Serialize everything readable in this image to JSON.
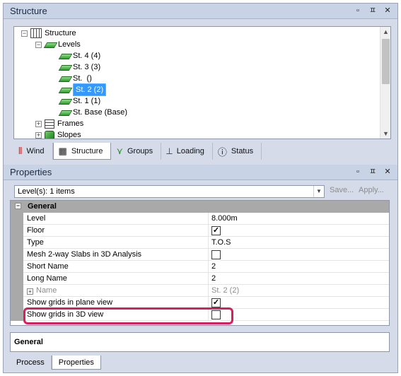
{
  "structure_panel": {
    "title": "Structure",
    "controls": [
      "▫",
      "ㅍ",
      "✕"
    ],
    "tree": {
      "root": "Structure",
      "levels_label": "Levels",
      "levels": [
        "St. 4 (4)",
        "St. 3 (3)",
        "St.  ()",
        "St. 2 (2)",
        "St. 1 (1)",
        "St. Base (Base)"
      ],
      "selected_level": "St. 2 (2)",
      "frames": "Frames",
      "slopes": "Slopes"
    },
    "tabs": [
      {
        "label": "Wind",
        "icon": "wind-icon"
      },
      {
        "label": "Structure",
        "icon": "structure-icon"
      },
      {
        "label": "Groups",
        "icon": "groups-icon"
      },
      {
        "label": "Loading",
        "icon": "loading-icon"
      },
      {
        "label": "Status",
        "icon": "status-icon"
      }
    ],
    "active_tab": "Structure"
  },
  "properties_panel": {
    "title": "Properties",
    "controls": [
      "▫",
      "ㅍ",
      "✕"
    ],
    "selector_value": "Level(s): 1 items",
    "save_label": "Save...",
    "apply_label": "Apply...",
    "category": "General",
    "rows": [
      {
        "name": "Level",
        "value": "8.000m"
      },
      {
        "name": "Floor",
        "checked": true
      },
      {
        "name": "Type",
        "value": "T.O.S"
      },
      {
        "name": "Mesh 2-way Slabs in 3D Analysis",
        "checked": false
      },
      {
        "name": "Short Name",
        "value": "2"
      },
      {
        "name": "Long Name",
        "value": "2"
      },
      {
        "name": "Name",
        "value": "St. 2 (2)"
      },
      {
        "name": "Show grids in plane view",
        "checked": true
      },
      {
        "name": "Show grids in 3D view",
        "checked": false
      }
    ],
    "description_heading": "General"
  },
  "bottom_tabs": [
    "Process",
    "Properties"
  ],
  "active_bottom_tab": "Properties",
  "colors": {
    "highlight": "#d61f5d",
    "selection": "#3399ff",
    "category_bg": "#a9a9a9"
  }
}
